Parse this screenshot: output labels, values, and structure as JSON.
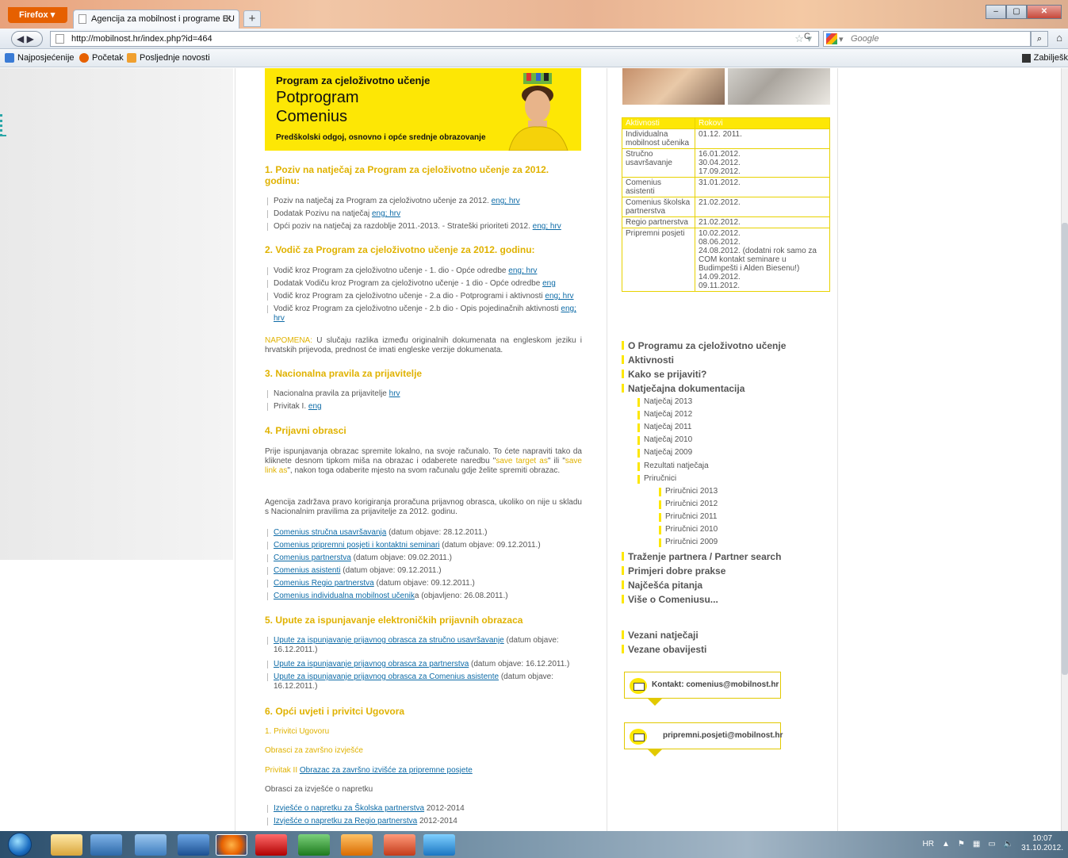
{
  "browser": {
    "menu_label": "Firefox",
    "tab_title": "Agencija za mobilnost i programe EU",
    "url": "http://mobilnost.hr/index.php?id=464",
    "search_placeholder": "Google",
    "bookmarks": [
      "Najposjećenije",
      "Početak",
      "Posljednje novosti"
    ],
    "bookmarks_right": "Zabilješk"
  },
  "banner": {
    "line1": "Program za cjeloživotno učenje",
    "line2": "Potprogram",
    "line3": "Comenius",
    "line4": "Predškolski odgoj, osnovno i opće srednje obrazovanje"
  },
  "sections": {
    "s1": {
      "title": "1. Poziv na natječaj za Program za cjeloživotno učenje za 2012. godinu:",
      "items": [
        {
          "text": "Poziv na natječaj za Program za cjeloživotno učenje za 2012.",
          "links": "eng;  hrv"
        },
        {
          "text": "Dodatak Pozivu na natječaj",
          "links": "eng; hrv"
        },
        {
          "text": "Opći poziv na natječaj za razdoblje 2011.-2013. - Strateški prioriteti 2012.",
          "links": "eng; hrv"
        }
      ]
    },
    "s2": {
      "title": "2. Vodič za Program za cjeloživotno učenje za 2012. godinu:",
      "items": [
        {
          "text": "Vodič kroz Program za cjeloživotno učenje - 1. dio - Opće odredbe",
          "links": "eng; hrv"
        },
        {
          "text": "Dodatak Vodiču kroz Program za cjeloživotno učenje - 1 dio - Opće odredbe",
          "links": "eng"
        },
        {
          "text": "Vodič kroz Program za cjeloživotno učenje - 2.a dio - Potprogrami i aktivnosti",
          "links": "eng; hrv"
        },
        {
          "text": "Vodič kroz Program za cjeloživotno učenje - 2.b dio - Opis pojedinačnih aktivnosti",
          "links": "eng; hrv"
        }
      ],
      "note_label": "NAPOMENA:",
      "note_text": "U slučaju razlika između originalnih dokumenata na engleskom jeziku i hrvatskih prijevoda, prednost će imati engleske verzije dokumenata."
    },
    "s3": {
      "title": "3. Nacionalna pravila za prijavitelje",
      "items": [
        {
          "text": "Nacionalna pravila za prijavitelje",
          "links": "hrv"
        },
        {
          "text": "Privitak I.",
          "links": "eng"
        }
      ]
    },
    "s4": {
      "title": "4. Prijavni obrasci",
      "para1_a": "Prije ispunjavanja obrazac spremite lokalno, na svoje računalo. To ćete napraviti tako da kliknete desnom tipkom miša na obrazac i odaberete naredbu \"",
      "para1_hl1": "save target as",
      "para1_b": "\" ili \"",
      "para1_hl2": "save link as",
      "para1_c": "\", nakon toga odaberite mjesto na svom računalu gdje želite spremiti obrazac.",
      "para2": "Agencija zadržava pravo korigiranja proračuna prijavnog obrasca, ukoliko on nije u skladu s Nacionalnim pravilima za prijavitelje za 2012. godinu.",
      "items": [
        {
          "link": "Comenius stručna usavršavanja",
          "text": " (datum objave: 28.12.2011.)"
        },
        {
          "link": "Comenius pripremni posjeti i kontaktni seminari",
          "text": " (datum objave: 09.12.2011.)"
        },
        {
          "link": "Comenius partnerstva",
          "text": " (datum objave: 09.02.2011.)"
        },
        {
          "link": "Comenius asistenti",
          "text": " (datum objave: 09.12.2011.)"
        },
        {
          "link": "Comenius Regio partnerstva",
          "text": " (datum objave: 09.12.2011.)"
        },
        {
          "link": "Comenius individualna mobilnost učenik",
          "text": "a (objavljeno: 26.08.2011.)"
        }
      ]
    },
    "s5": {
      "title": "5. Upute za ispunjavanje elektroničkih prijavnih obrazaca",
      "items": [
        {
          "link": "Upute za ispunjavanje prijavnog obrasca za stručno usavršavanje",
          "text": " (datum objave: 16.12.2011.)"
        },
        {
          "link": "Upute za ispunjavanje prijavnog obrasca za partnerstva",
          "text": " (datum objave: 16.12.2011.)"
        },
        {
          "link": "Upute za ispunjavanje prijavnog obrasca za Comenius asistente",
          "text": " (datum objave: 16.12.2011.)"
        }
      ]
    },
    "s6": {
      "title": "6. Opći uvjeti i privitci Ugovora",
      "sub1": "1. Privitci Ugovoru",
      "sub2": "Obrasci za završno izvješće",
      "privitak_label": "Privitak II",
      "privitak_link": "Obrazac za završno izvišće za pripremne posjete",
      "sub3": "Obrasci za izvješće o napretku",
      "items": [
        {
          "link": "Izvješće o napretku za Školska partnerstva",
          "text": " 2012-2014"
        },
        {
          "link": "Izvješće o napretku za Regio partnerstva",
          "text": " 2012-2014"
        }
      ]
    }
  },
  "sidebar": {
    "table_headers": [
      "Aktivnosti",
      "Rokovi"
    ],
    "table_rows": [
      [
        "Individualna mobilnost učenika",
        "01.12. 2011."
      ],
      [
        "Stručno usavršavanje",
        "16.01.2012.\n30.04.2012.\n17.09.2012."
      ],
      [
        "Comenius asistenti",
        "31.01.2012."
      ],
      [
        "Comenius školska partnerstva",
        "21.02.2012."
      ],
      [
        "Regio partnerstva",
        "21.02.2012."
      ],
      [
        "Pripremni posjeti",
        "10.02.2012.\n08.06.2012.\n24.08.2012. (dodatni rok samo za COM kontakt seminare u Budimpešti i Alden Biesenu!)\n14.09.2012.\n09.11.2012."
      ]
    ],
    "nav_main": [
      "O Programu za cjeloživotno učenje",
      "Aktivnosti",
      "Kako se prijaviti?",
      "Natječajna dokumentacija"
    ],
    "nav_sub": [
      "Natječaj 2013",
      "Natječaj 2012",
      "Natječaj 2011",
      "Natječaj 2010",
      "Natječaj 2009",
      "Rezultati natječaja",
      "Priručnici"
    ],
    "nav_subsub": [
      "Priručnici 2013",
      "Priručnici 2012",
      "Priručnici 2011",
      "Priručnici 2010",
      "Priručnici 2009"
    ],
    "nav_main2": [
      "Traženje partnera / Partner search",
      "Primjeri dobre prakse",
      "Najčešća pitanja",
      "Više o Comeniusu..."
    ],
    "nav_main3": [
      "Vezani natječaji",
      "Vezane obavijesti"
    ],
    "contact1": "Kontakt: comenius@mobilnost.hr",
    "contact2": "pripremni.posjeti@mobilnost.hr"
  },
  "taskbar": {
    "lang": "HR",
    "time": "10:07",
    "date": "31.10.2012."
  }
}
